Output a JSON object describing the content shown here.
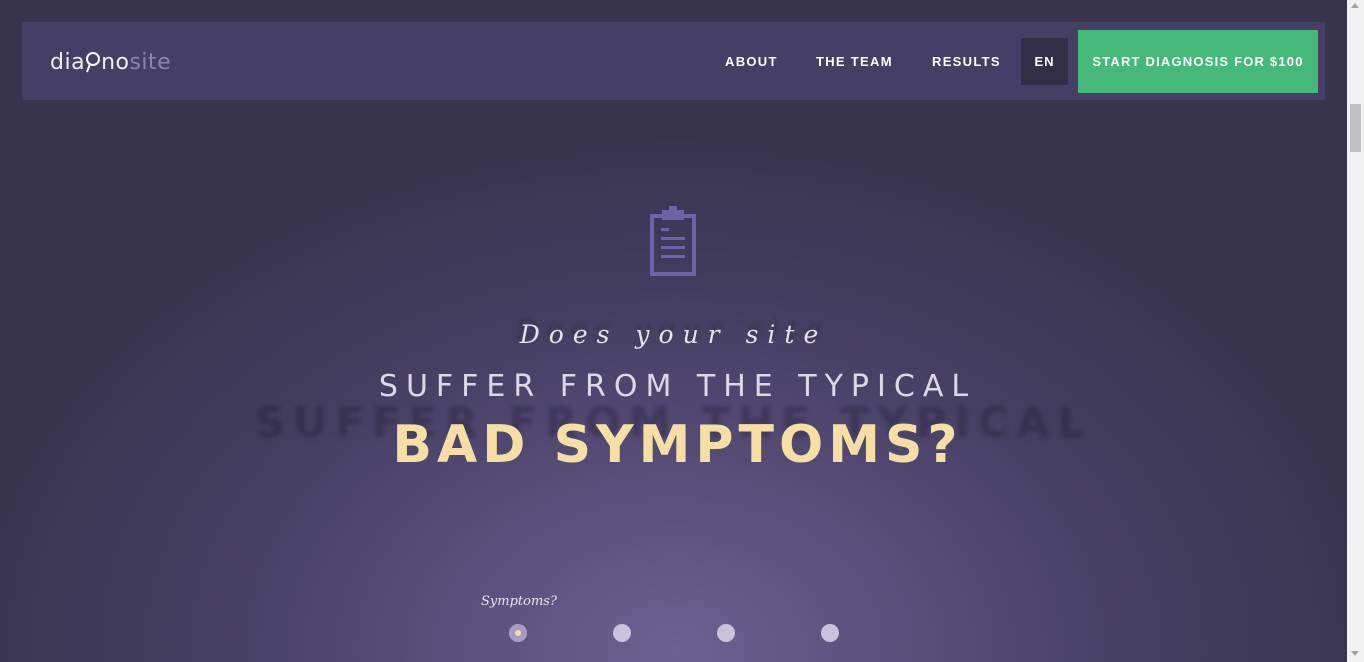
{
  "logo": {
    "part1": "dia",
    "part2": "no",
    "part3": "site"
  },
  "nav": {
    "links": [
      "ABOUT",
      "THE TEAM",
      "RESULTS"
    ],
    "language": "EN",
    "cta": "START DIAGNOSIS FOR $100"
  },
  "hero": {
    "icon": "clipboard-icon",
    "line1": "Does your site",
    "line2": "SUFFER FROM THE TYPICAL",
    "line3": "BAD SYMPTOMS?"
  },
  "steps": {
    "label": "Symptoms?",
    "count": 4,
    "active_index": 0
  },
  "colors": {
    "accent_green": "#45b87a",
    "headline_gold": "#f5dfa4",
    "background": "#3a3552"
  }
}
